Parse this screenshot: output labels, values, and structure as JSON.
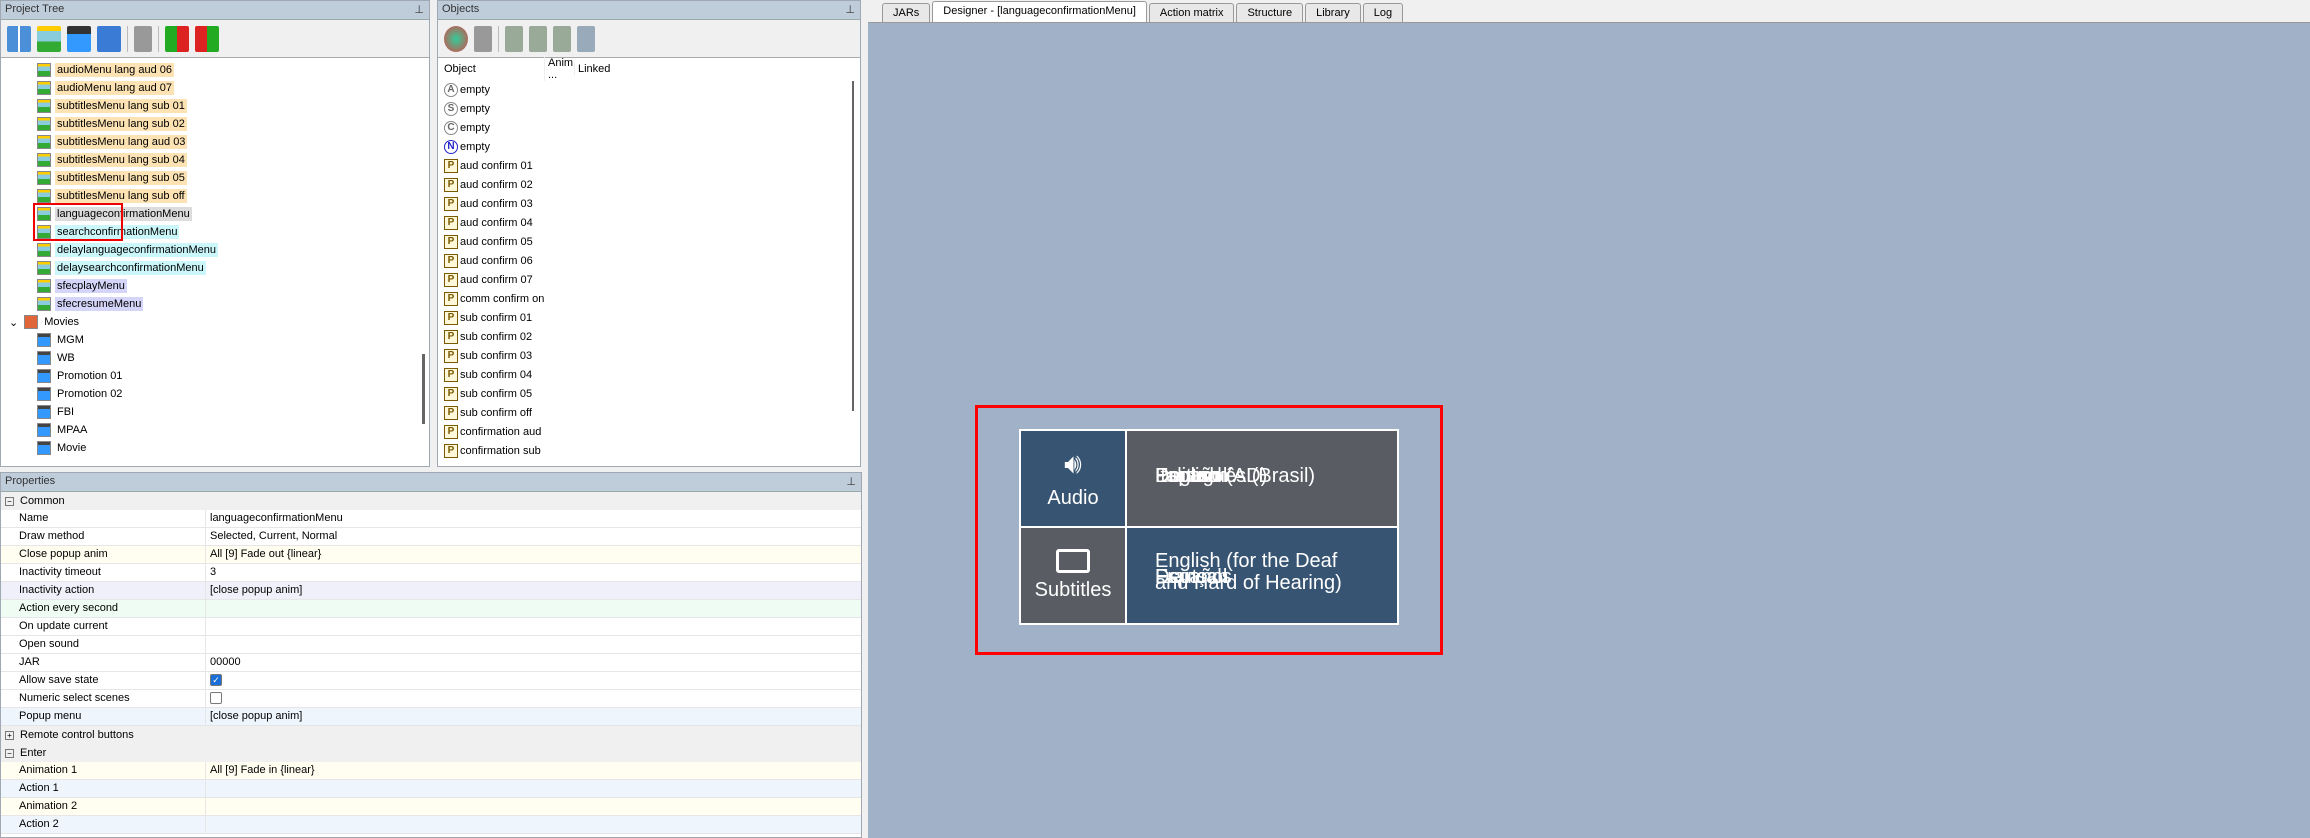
{
  "project_tree": {
    "title": "Project Tree",
    "items": [
      {
        "label": "audioMenu lang aud 06",
        "style": "or"
      },
      {
        "label": "audioMenu lang aud 07",
        "style": "or"
      },
      {
        "label": "subtitlesMenu lang sub 01",
        "style": "or"
      },
      {
        "label": "subtitlesMenu lang sub 02",
        "style": "or"
      },
      {
        "label": "subtitlesMenu lang aud 03",
        "style": "or"
      },
      {
        "label": "subtitlesMenu lang sub 04",
        "style": "or"
      },
      {
        "label": "subtitlesMenu lang sub 05",
        "style": "or"
      },
      {
        "label": "subtitlesMenu lang sub off",
        "style": "or"
      },
      {
        "label": "languageconfirmationMenu",
        "style": "sel"
      },
      {
        "label": "searchconfirmationMenu",
        "style": "cy"
      },
      {
        "label": "delaylanguageconfirmationMenu",
        "style": "cy"
      },
      {
        "label": "delaysearchconfirmationMenu",
        "style": "cy"
      },
      {
        "label": "sfecplayMenu",
        "style": "pu"
      },
      {
        "label": "sfecresumeMenu",
        "style": "pu"
      }
    ],
    "folder": "Movies",
    "movies": [
      "MGM",
      "WB",
      "Promotion 01",
      "Promotion 02",
      "FBI",
      "MPAA",
      "Movie"
    ]
  },
  "objects": {
    "title": "Objects",
    "columns": [
      "Object",
      "Anim ...",
      "Linked"
    ],
    "items": [
      {
        "icon": "A",
        "label": "empty"
      },
      {
        "icon": "S",
        "label": "empty"
      },
      {
        "icon": "C",
        "label": "empty"
      },
      {
        "icon": "N",
        "label": "empty"
      },
      {
        "icon": "P",
        "label": "aud confirm 01"
      },
      {
        "icon": "P",
        "label": "aud confirm 02"
      },
      {
        "icon": "P",
        "label": "aud confirm 03"
      },
      {
        "icon": "P",
        "label": "aud confirm 04"
      },
      {
        "icon": "P",
        "label": "aud confirm 05"
      },
      {
        "icon": "P",
        "label": "aud confirm 06"
      },
      {
        "icon": "P",
        "label": "aud confirm 07"
      },
      {
        "icon": "P",
        "label": "comm confirm on"
      },
      {
        "icon": "P",
        "label": "sub confirm 01"
      },
      {
        "icon": "P",
        "label": "sub confirm 02"
      },
      {
        "icon": "P",
        "label": "sub confirm 03"
      },
      {
        "icon": "P",
        "label": "sub confirm 04"
      },
      {
        "icon": "P",
        "label": "sub confirm 05"
      },
      {
        "icon": "P",
        "label": "sub confirm off"
      },
      {
        "icon": "P",
        "label": "confirmation aud"
      },
      {
        "icon": "P",
        "label": "confirmation sub"
      }
    ]
  },
  "properties": {
    "title": "Properties",
    "common": "Common",
    "rows": [
      {
        "k": "Name",
        "v": "languageconfirmationMenu",
        "bg": "#fff"
      },
      {
        "k": "Draw method",
        "v": "Selected, Current, Normal",
        "bg": "#fff"
      },
      {
        "k": "Close popup anim",
        "v": "All [9] Fade out {linear}",
        "bg": "#fffef0"
      },
      {
        "k": "Inactivity timeout",
        "v": "3",
        "bg": "#fff"
      },
      {
        "k": "Inactivity action",
        "v": "[close popup anim]",
        "bg": "#f0f0fa"
      },
      {
        "k": "Action every second",
        "v": "",
        "bg": "#effcf4"
      },
      {
        "k": "On update current",
        "v": "",
        "bg": "#fff"
      },
      {
        "k": "Open sound",
        "v": "",
        "bg": "#fff"
      },
      {
        "k": "JAR",
        "v": "00000",
        "bg": "#fff"
      },
      {
        "k": "Allow save state",
        "v": "",
        "check": true,
        "bg": "#fff"
      },
      {
        "k": "Numeric select scenes",
        "v": "",
        "check": false,
        "bg": "#fff"
      },
      {
        "k": "Popup menu",
        "v": "[close popup anim]",
        "bg": "#eef5fd"
      }
    ],
    "remote": "Remote control buttons",
    "enter": "Enter",
    "enter_rows": [
      {
        "k": "Animation 1",
        "v": "All [9] Fade in {linear}",
        "bg": "#fffef0"
      },
      {
        "k": "Action 1",
        "v": "",
        "bg": "#eef5fd"
      },
      {
        "k": "Animation 2",
        "v": "",
        "bg": "#fffef0"
      },
      {
        "k": "Action 2",
        "v": "",
        "bg": "#eef5fd"
      }
    ]
  },
  "tabs": [
    {
      "label": "JARs"
    },
    {
      "label": "Designer - [languageconfirmationMenu]",
      "active": true
    },
    {
      "label": "Action matrix"
    },
    {
      "label": "Structure"
    },
    {
      "label": "Library"
    },
    {
      "label": "Log"
    }
  ],
  "designer": {
    "audio_label": "Audio",
    "subtitles_label": "Subtitles",
    "audio_overlap": [
      "Deutsch",
      "English (AD)",
      "Português (Brasil)",
      "Español",
      "Italiano"
    ],
    "subtitle_overlap": [
      "English (for the Deaf",
      "and Hard of Hearing)",
      "Deutsch",
      "Español",
      "Français"
    ],
    "highlight_color": "#ff0000"
  }
}
